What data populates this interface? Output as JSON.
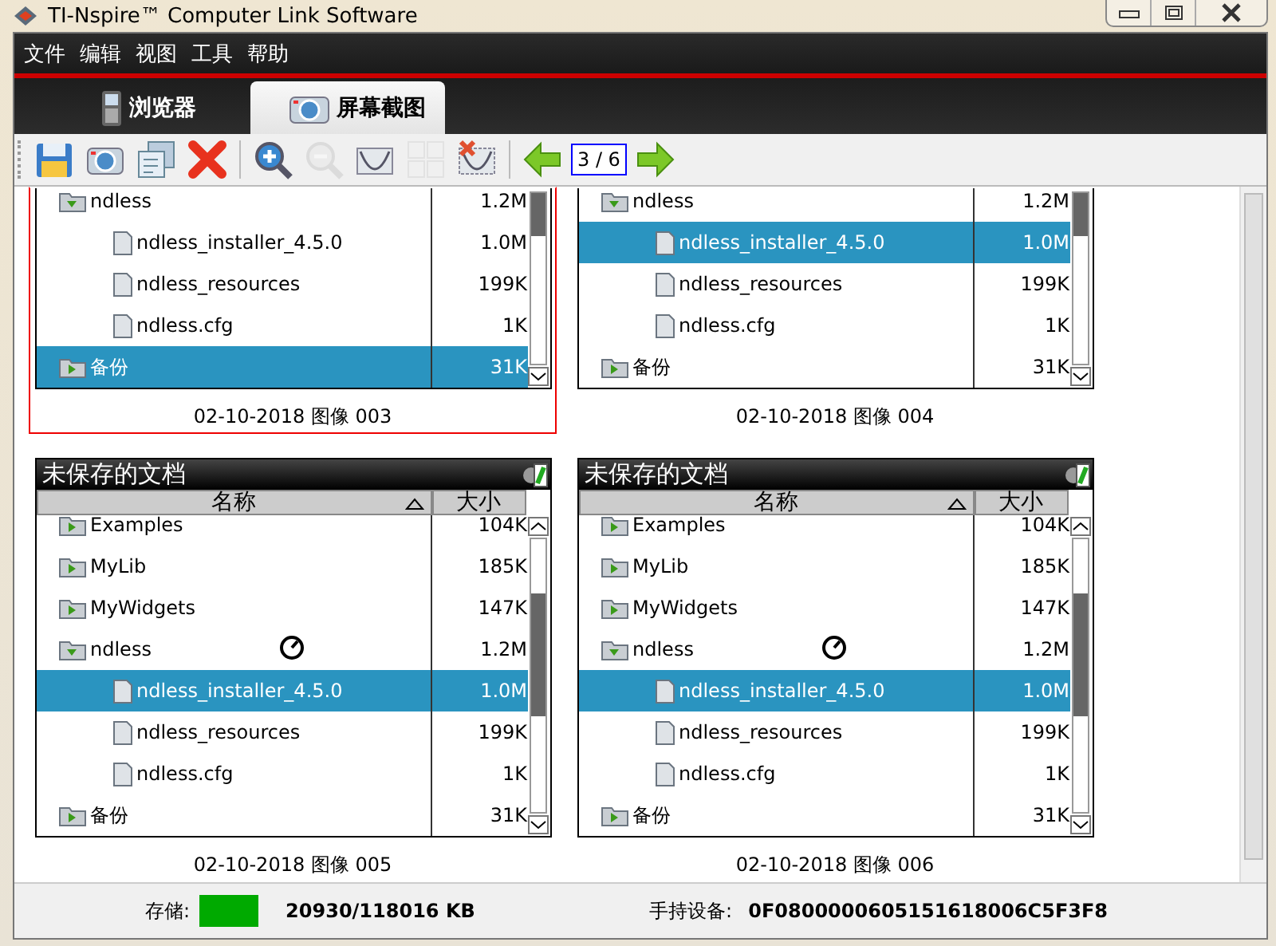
{
  "window": {
    "title": "TI-Nspire™ Computer Link Software"
  },
  "menu": [
    "文件",
    "编辑",
    "视图",
    "工具",
    "帮助"
  ],
  "tabs": [
    {
      "label": "浏览器",
      "kind": "handheld",
      "selected": false
    },
    {
      "label": "屏幕截图",
      "kind": "camera",
      "selected": true
    }
  ],
  "toolbar": {
    "groups": [
      [
        {
          "kind": "save",
          "disabled": false
        },
        {
          "kind": "camera",
          "disabled": false
        },
        {
          "kind": "copy",
          "disabled": false
        },
        {
          "kind": "delete",
          "disabled": false
        }
      ],
      [
        {
          "kind": "zoom-in",
          "disabled": false
        },
        {
          "kind": "zoom-out",
          "disabled": true
        },
        {
          "kind": "graph",
          "disabled": false
        },
        {
          "kind": "grid",
          "disabled": true
        },
        {
          "kind": "graph-delete",
          "disabled": false
        }
      ],
      [
        {
          "kind": "back",
          "disabled": false
        },
        {
          "kind": "forward",
          "disabled": false
        }
      ]
    ],
    "page_indicator": "3 / 6"
  },
  "screenshots": [
    {
      "caption": "02-10-2018 图像 003",
      "selected": true,
      "screen": {
        "rows": [
          {
            "kind": "folder",
            "name": "ndless",
            "size": "1.2M",
            "expanded": true,
            "selected": false,
            "children": [
              {
                "kind": "file",
                "name": "ndless_installer_4.5.0",
                "size": "1.0M",
                "selected": false
              },
              {
                "kind": "file",
                "name": "ndless_resources",
                "size": "199K",
                "selected": false
              },
              {
                "kind": "file",
                "name": "ndless.cfg",
                "size": "1K",
                "selected": false
              }
            ]
          },
          {
            "kind": "folder",
            "name": "备份",
            "size": "31K",
            "expanded": false,
            "selected": true
          }
        ]
      }
    },
    {
      "caption": "02-10-2018 图像 004",
      "selected": false,
      "screen": {
        "rows": [
          {
            "kind": "folder",
            "name": "ndless",
            "size": "1.2M",
            "expanded": true,
            "selected": false,
            "children": [
              {
                "kind": "file",
                "name": "ndless_installer_4.5.0",
                "size": "1.0M",
                "selected": true
              },
              {
                "kind": "file",
                "name": "ndless_resources",
                "size": "199K",
                "selected": false
              },
              {
                "kind": "file",
                "name": "ndless.cfg",
                "size": "1K",
                "selected": false
              }
            ]
          },
          {
            "kind": "folder",
            "name": "备份",
            "size": "31K",
            "expanded": false,
            "selected": false
          }
        ]
      }
    },
    {
      "caption": "02-10-2018 图像 005",
      "selected": false,
      "screen": {
        "title": "未保存的文档",
        "pointer": true,
        "columns": [
          {
            "label": "名称",
            "sorted": true
          },
          {
            "label": "大小",
            "sorted": false
          }
        ],
        "rows": [
          {
            "kind": "folder",
            "name": "Examples",
            "size": "104K",
            "expanded": false,
            "selected": false
          },
          {
            "kind": "folder",
            "name": "MyLib",
            "size": "185K",
            "expanded": false,
            "selected": false
          },
          {
            "kind": "folder",
            "name": "MyWidgets",
            "size": "147K",
            "expanded": false,
            "selected": false
          },
          {
            "kind": "folder",
            "name": "ndless",
            "size": "1.2M",
            "expanded": true,
            "selected": false,
            "children": [
              {
                "kind": "file",
                "name": "ndless_installer_4.5.0",
                "size": "1.0M",
                "selected": true
              },
              {
                "kind": "file",
                "name": "ndless_resources",
                "size": "199K",
                "selected": false
              },
              {
                "kind": "file",
                "name": "ndless.cfg",
                "size": "1K",
                "selected": false
              }
            ]
          },
          {
            "kind": "folder",
            "name": "备份",
            "size": "31K",
            "expanded": false,
            "selected": false
          }
        ]
      }
    },
    {
      "caption": "02-10-2018 图像 006",
      "selected": false,
      "screen": {
        "title": "未保存的文档",
        "pointer": true,
        "columns": [
          {
            "label": "名称",
            "sorted": true
          },
          {
            "label": "大小",
            "sorted": false
          }
        ],
        "rows": [
          {
            "kind": "folder",
            "name": "Examples",
            "size": "104K",
            "expanded": false,
            "selected": false
          },
          {
            "kind": "folder",
            "name": "MyLib",
            "size": "185K",
            "expanded": false,
            "selected": false
          },
          {
            "kind": "folder",
            "name": "MyWidgets",
            "size": "147K",
            "expanded": false,
            "selected": false
          },
          {
            "kind": "folder",
            "name": "ndless",
            "size": "1.2M",
            "expanded": true,
            "selected": false,
            "children": [
              {
                "kind": "file",
                "name": "ndless_installer_4.5.0",
                "size": "1.0M",
                "selected": true
              },
              {
                "kind": "file",
                "name": "ndless_resources",
                "size": "199K",
                "selected": false
              },
              {
                "kind": "file",
                "name": "ndless.cfg",
                "size": "1K",
                "selected": false
              }
            ]
          },
          {
            "kind": "folder",
            "name": "备份",
            "size": "31K",
            "expanded": false,
            "selected": false
          }
        ]
      }
    }
  ],
  "status_bar": {
    "storage_label": "存储:",
    "storage_value": "20930/118016 KB",
    "device_label": "手持设备:",
    "device_id": "0F0800000605151618006C5F3F8"
  }
}
